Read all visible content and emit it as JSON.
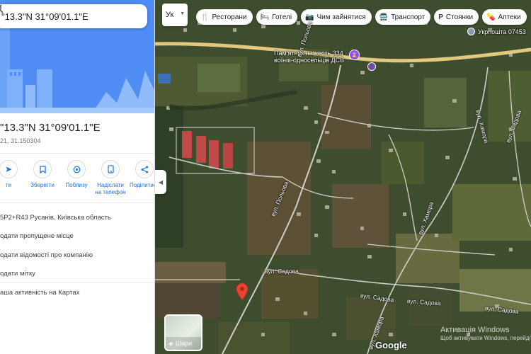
{
  "search": {
    "query": "\"13.3\"N 31°09'01.1\"E"
  },
  "place": {
    "title": "\"13.3\"N 31°09'01.1\"E",
    "coords": "21, 31.150304"
  },
  "actions": [
    {
      "icon": "route-icon",
      "label": "ти"
    },
    {
      "icon": "bookmark-icon",
      "label": "Зберегти"
    },
    {
      "icon": "nearby-icon",
      "label": "Поблизу"
    },
    {
      "icon": "send-to-phone-icon",
      "label": "Надіслати\nна телефон"
    },
    {
      "icon": "share-icon",
      "label": "Поділитися"
    }
  ],
  "info": [
    "5P2+R43 Русанів, Київська область",
    "одати пропущене місце",
    "одати відомості про компанію",
    "одати мітку",
    "аша активність на Картах"
  ],
  "map": {
    "language_button": "Ук",
    "chips": [
      {
        "icon": "restaurant-icon",
        "label": "Ресторани"
      },
      {
        "icon": "hotel-icon",
        "label": "Готелі"
      },
      {
        "icon": "camera-icon",
        "label": "Чим зайнятися"
      },
      {
        "icon": "transit-icon",
        "label": "Транспорт"
      },
      {
        "icon": "parking-icon",
        "label": "Стоянки"
      },
      {
        "icon": "pharmacy-icon",
        "label": "Аптеки"
      }
    ],
    "labels": {
      "post_office": "Укрпошта 07453",
      "monument_line1": "Пам'ятник на честь 334",
      "monument_line2": "воїнів-односельців ДСВ"
    },
    "streets": {
      "polova": "вул. Польова",
      "sadova_1": "вул. Садова",
      "sadova_2": "вул. Садова",
      "sadova_3": "вул. Садова",
      "sadova_4": "вул. Садова",
      "sadova_5": "вул. Садова",
      "khamora_1": "вул. Хамора",
      "khamora_2": "вул. Хамора",
      "khamora_3": "вул. Хамора"
    },
    "layers_label": "Шари",
    "logo": "Google",
    "watermark_line1": "Активація Windows",
    "watermark_line2": "Щоб активувати Windows, перейдіть до"
  }
}
